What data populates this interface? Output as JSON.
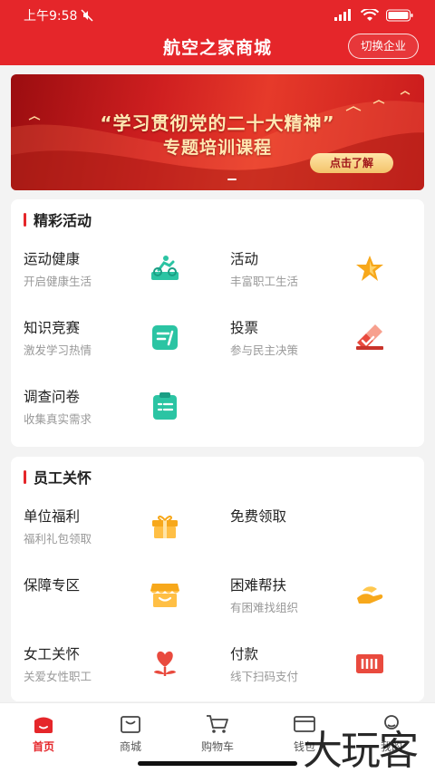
{
  "status_bar": {
    "time": "上午9:58"
  },
  "header": {
    "title": "航空之家商城",
    "switch_label": "切换企业",
    "bg_color": "#e5262a"
  },
  "banner": {
    "line1": "“学习贯彻党的二十大精神”",
    "line2": "专题培训课程",
    "button_label": "点击了解"
  },
  "sections": [
    {
      "title": "精彩活动",
      "items": [
        {
          "name": "运动健康",
          "desc": "开启健康生活",
          "icon": "sport-icon"
        },
        {
          "name": "活动",
          "desc": "丰富职工生活",
          "icon": "star-icon"
        },
        {
          "name": "知识竞赛",
          "desc": "激发学习热情",
          "icon": "quiz-icon"
        },
        {
          "name": "投票",
          "desc": "参与民主决策",
          "icon": "vote-icon"
        },
        {
          "name": "调查问卷",
          "desc": "收集真实需求",
          "icon": "survey-icon"
        }
      ]
    },
    {
      "title": "员工关怀",
      "items": [
        {
          "name": "单位福利",
          "desc": "福利礼包领取",
          "icon": "gift-icon"
        },
        {
          "name": "免费领取",
          "desc": "",
          "icon": ""
        },
        {
          "name": "保障专区",
          "desc": "",
          "icon": "shop-icon"
        },
        {
          "name": "困难帮扶",
          "desc": "有困难找组织",
          "icon": "help-hand-icon"
        },
        {
          "name": "女工关怀",
          "desc": "关爱女性职工",
          "icon": "heart-flower-icon"
        },
        {
          "name": "付款",
          "desc": "线下扫码支付",
          "icon": "pay-icon"
        }
      ]
    }
  ],
  "tabbar": [
    {
      "label": "首页",
      "icon": "home-icon",
      "active": true
    },
    {
      "label": "商城",
      "icon": "mall-icon",
      "active": false
    },
    {
      "label": "购物车",
      "icon": "cart-icon",
      "active": false
    },
    {
      "label": "钱包",
      "icon": "wallet-icon",
      "active": false
    },
    {
      "label": "我的",
      "icon": "user-icon",
      "active": false
    }
  ],
  "watermark": "大玩客"
}
